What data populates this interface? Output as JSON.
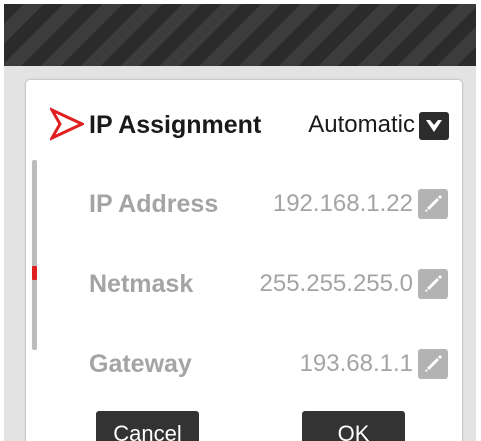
{
  "dialog": {
    "rows": [
      {
        "label": "IP Assignment",
        "value": "Automatic",
        "state": "active",
        "control": "dropdown"
      },
      {
        "label": "IP Address",
        "value": "192.168.1.22",
        "state": "dimmed",
        "control": "edit"
      },
      {
        "label": "Netmask",
        "value": "255.255.255.0",
        "state": "dimmed",
        "control": "edit"
      },
      {
        "label": "Gateway",
        "value": "193.68.1.1",
        "state": "dimmed",
        "control": "edit"
      }
    ],
    "buttons": {
      "cancel": "Cancel",
      "ok": "OK"
    }
  },
  "icons": {
    "selection_marker": "chevron-right-outline-icon",
    "dropdown": "chevron-down-icon",
    "edit": "pencil-icon"
  },
  "colors": {
    "accent": "#e02020",
    "active_text": "#1a1a1a",
    "dimmed_text": "#a4a4a4",
    "header": "#2b2b2b",
    "button": "#333333",
    "edit_button": "#b3b3b3",
    "backdrop": "#e3e3e3"
  }
}
